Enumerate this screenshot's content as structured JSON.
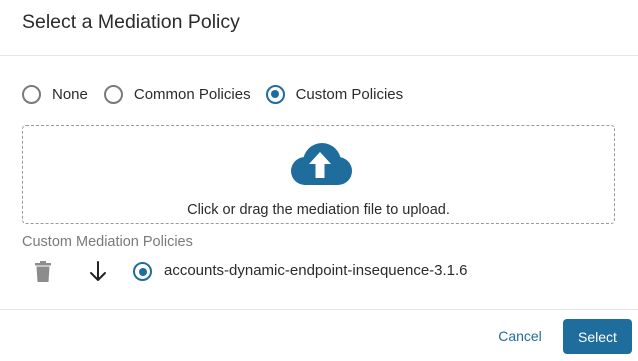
{
  "dialog": {
    "title": "Select a Mediation Policy"
  },
  "policy_type": {
    "options": [
      {
        "label": "None",
        "selected": false
      },
      {
        "label": "Common Policies",
        "selected": false
      },
      {
        "label": "Custom Policies",
        "selected": true
      }
    ]
  },
  "upload": {
    "icon": "cloud-upload-icon",
    "text": "Click or drag the mediation file to upload."
  },
  "custom_policies": {
    "label": "Custom Mediation Policies",
    "items": [
      {
        "name": "accounts-dynamic-endpoint-insequence-3.1.6",
        "selected": true,
        "delete_icon": "trash-icon",
        "download_icon": "download-arrow-icon"
      }
    ]
  },
  "actions": {
    "cancel_label": "Cancel",
    "select_label": "Select"
  },
  "colors": {
    "accent": "#1f6d9c",
    "muted_text": "#7a7a7a",
    "icon_gray": "#8c8c8c"
  }
}
